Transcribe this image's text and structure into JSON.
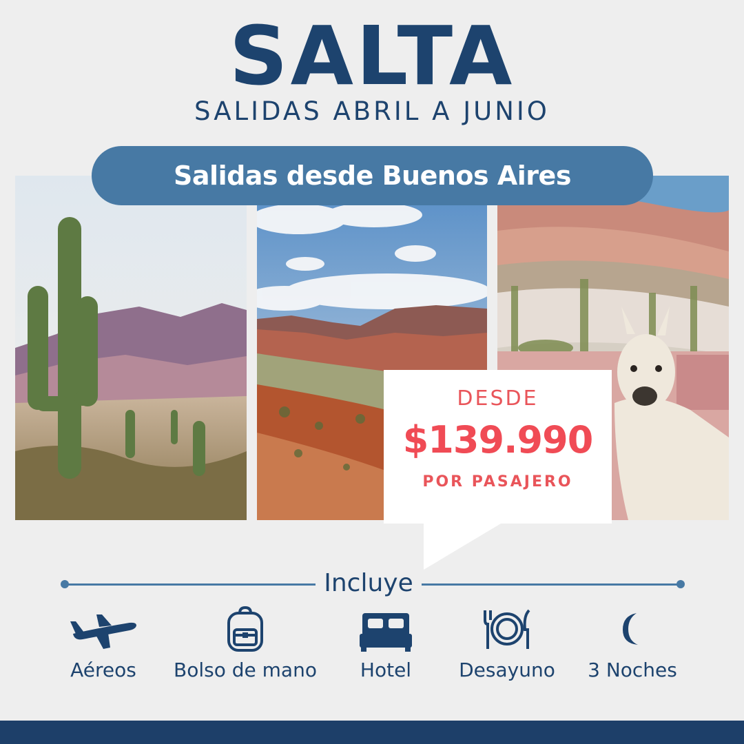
{
  "header": {
    "title": "SALTA",
    "subtitle": "SALIDAS ABRIL A JUNIO",
    "departure_banner": "Salidas desde Buenos Aires"
  },
  "price": {
    "prefix": "DESDE",
    "amount": "$139.990",
    "unit": "POR PASAJERO"
  },
  "includes": {
    "heading": "Incluye",
    "items": [
      {
        "label": "Aéreos",
        "icon": "airplane-icon"
      },
      {
        "label": "Bolso de mano",
        "icon": "backpack-icon"
      },
      {
        "label": "Hotel",
        "icon": "bed-icon"
      },
      {
        "label": "Desayuno",
        "icon": "plate-cutlery-icon"
      },
      {
        "label": "3 Noches",
        "icon": "moon-icon"
      }
    ]
  },
  "colors": {
    "navy": "#1d436e",
    "steel_blue": "#4779a4",
    "coral": "#f04b55",
    "background": "#eeeeee"
  }
}
